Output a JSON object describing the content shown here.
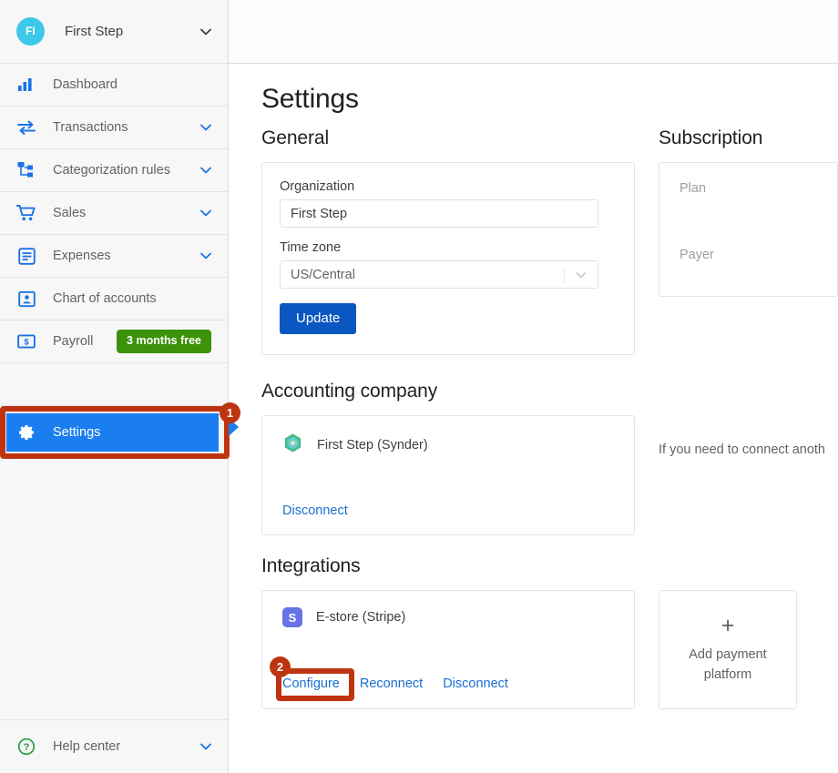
{
  "sidebar": {
    "org": {
      "initials": "FI",
      "name": "First Step"
    },
    "items": [
      {
        "label": "Dashboard",
        "icon": "bar-chart-icon",
        "chevron": false
      },
      {
        "label": "Transactions",
        "icon": "transfer-arrows-icon",
        "chevron": true
      },
      {
        "label": "Categorization rules",
        "icon": "sitemap-icon",
        "chevron": true
      },
      {
        "label": "Sales",
        "icon": "shopping-cart-icon",
        "chevron": true
      },
      {
        "label": "Expenses",
        "icon": "document-lines-icon",
        "chevron": true
      },
      {
        "label": "Chart of accounts",
        "icon": "contact-card-icon",
        "chevron": false
      },
      {
        "label": "Payroll",
        "icon": "money-bill-icon",
        "chevron": false,
        "badge": "3 months free"
      }
    ],
    "settings": {
      "label": "Settings",
      "icon": "gear-icon"
    },
    "help": {
      "label": "Help center",
      "icon": "question-circle-icon",
      "chevron": true
    }
  },
  "annotations": {
    "step1": "1",
    "step2": "2",
    "highlight_color": "#bf3410"
  },
  "page": {
    "title": "Settings"
  },
  "general": {
    "heading": "General",
    "organization_label": "Organization",
    "organization_value": "First Step",
    "timezone_label": "Time zone",
    "timezone_value": "US/Central",
    "update_button": "Update"
  },
  "subscription": {
    "heading": "Subscription",
    "plan_label": "Plan",
    "payer_label": "Payer"
  },
  "accounting_company": {
    "heading": "Accounting company",
    "entity_name": "First Step (Synder)",
    "entity_icon": "synder-hexagon-icon",
    "disconnect_label": "Disconnect",
    "side_note": "If you need to connect anoth"
  },
  "integrations": {
    "heading": "Integrations",
    "entity_name": "E-store (Stripe)",
    "entity_icon": "stripe-icon",
    "configure_label": "Configure",
    "reconnect_label": "Reconnect",
    "disconnect_label": "Disconnect",
    "add_card": {
      "icon": "plus-icon",
      "line1": "Add payment",
      "line2": "platform"
    }
  },
  "colors": {
    "accent_blue": "#1a7ef0",
    "button_blue": "#0b57c2",
    "link_blue": "#1a6fd4",
    "badge_green": "#3c9209",
    "avatar_cyan": "#3cc8e8",
    "stripe_purple": "#6772e5"
  }
}
